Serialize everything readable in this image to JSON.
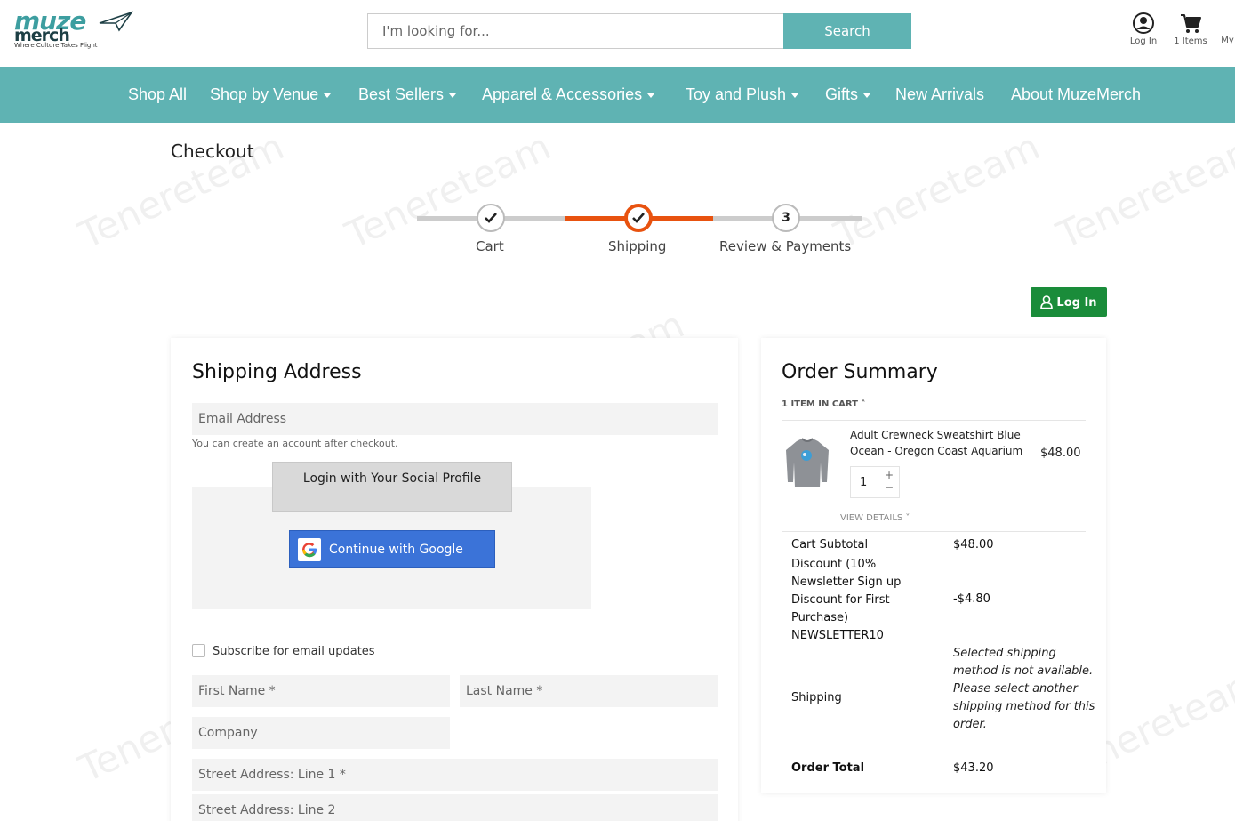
{
  "brand": {
    "word1": "muze",
    "word2": "merch",
    "tagline": "Where Culture Takes Flight"
  },
  "search": {
    "placeholder": "I'm looking for...",
    "button": "Search"
  },
  "header_icons": {
    "login": "Log In",
    "cart": "1 Items",
    "my": "My"
  },
  "nav": [
    {
      "label": "Shop All",
      "has_caret": false
    },
    {
      "label": "Shop by Venue",
      "has_caret": true
    },
    {
      "label": "Best Sellers",
      "has_caret": true
    },
    {
      "label": "Apparel & Accessories",
      "has_caret": true
    },
    {
      "label": "Toy and Plush",
      "has_caret": true
    },
    {
      "label": "Gifts",
      "has_caret": true
    },
    {
      "label": "New Arrivals",
      "has_caret": false
    },
    {
      "label": "About MuzeMerch",
      "has_caret": false
    }
  ],
  "page_title": "Checkout",
  "steps": [
    {
      "label": "Cart",
      "marker": "✓",
      "state": "done"
    },
    {
      "label": "Shipping",
      "marker": "✓",
      "state": "active"
    },
    {
      "label": "Review & Payments",
      "marker": "3",
      "state": "pending"
    }
  ],
  "login_button": "Log In",
  "shipping": {
    "title": "Shipping Address",
    "email_placeholder": "Email Address",
    "email_hint": "You can create an account after checkout.",
    "social_header": "Login with Your Social Profile",
    "google_button": "Continue with Google",
    "subscribe_label": "Subscribe for email updates",
    "first_name": "First Name *",
    "last_name": "Last Name *",
    "company": "Company",
    "street1": "Street Address: Line 1 *",
    "street2": "Street Address: Line 2"
  },
  "summary": {
    "title": "Order Summary",
    "items_in_cart": "1 ITEM IN CART",
    "product": {
      "name": "Adult Crewneck Sweatshirt Blue Ocean - Oregon Coast Aquarium",
      "price": "$48.00",
      "qty": "1"
    },
    "view_details": "VIEW DETAILS",
    "cart_subtotal_label": "Cart Subtotal",
    "cart_subtotal_value": "$48.00",
    "discount_label": "Discount (10% Newsletter Sign up Discount for First Purchase) NEWSLETTER10",
    "discount_value": "-$4.80",
    "shipping_label": "Shipping",
    "shipping_note": "Selected shipping method is not available. Please select another shipping method for this order.",
    "order_total_label": "Order Total",
    "order_total_value": "$43.20"
  },
  "colors": {
    "teal": "#5fb3b3",
    "progress_orange": "#e8520f",
    "login_green": "#1a8c3a",
    "google_blue": "#3b73d8"
  },
  "icons": [
    "user-circle-icon",
    "cart-icon",
    "check-icon",
    "google-g-icon",
    "user-icon",
    "paper-plane-icon"
  ]
}
